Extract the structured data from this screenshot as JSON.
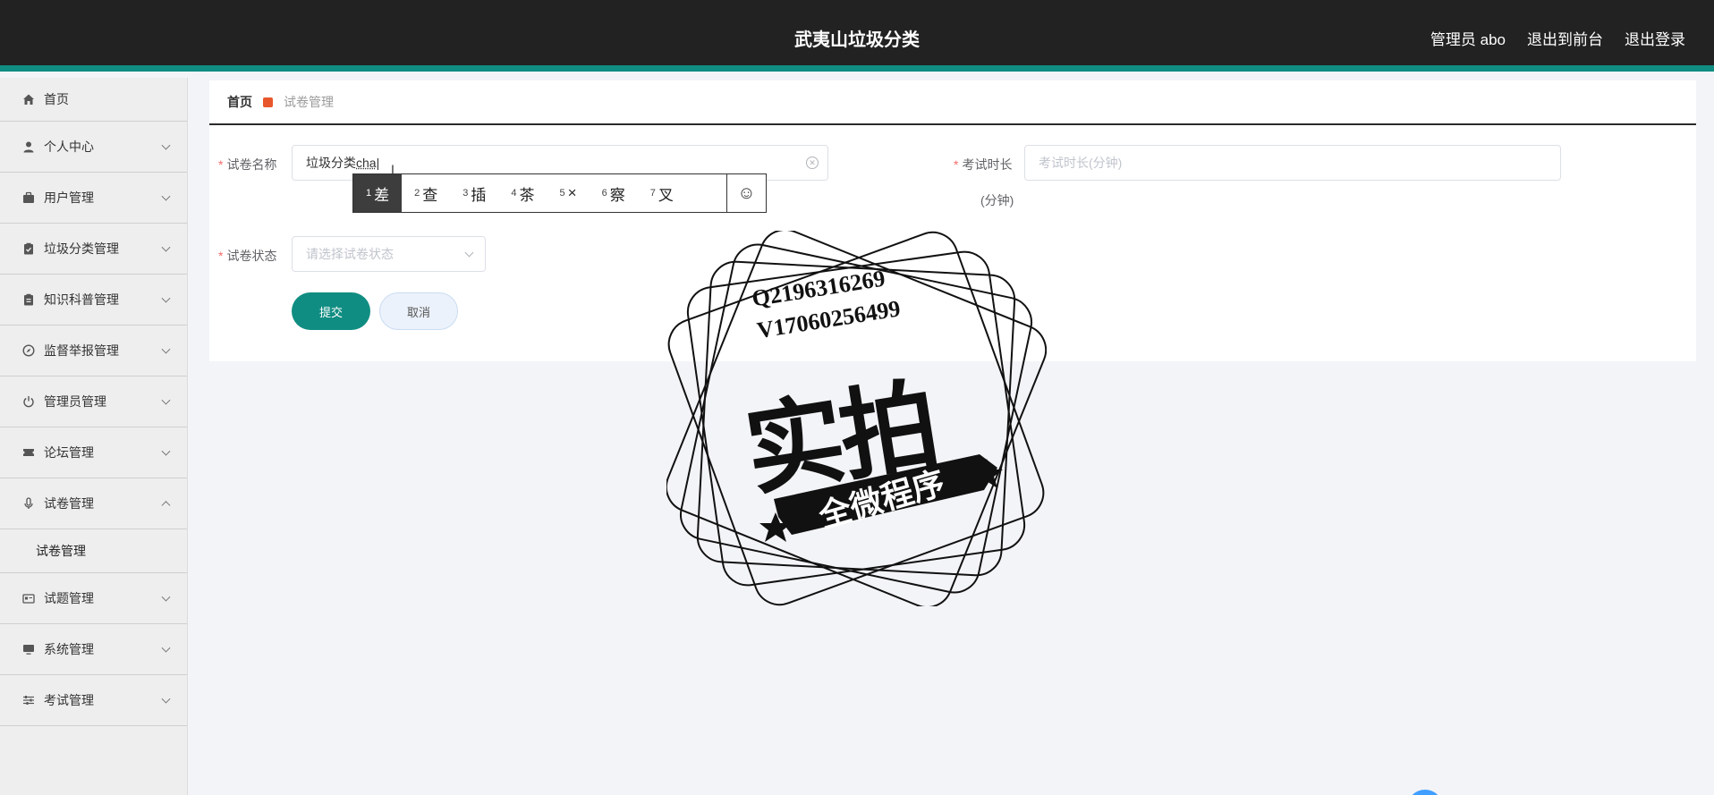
{
  "header": {
    "title": "武夷山垃圾分类",
    "links": [
      "管理员 abo",
      "退出到前台",
      "退出登录"
    ]
  },
  "sidebar": {
    "items": [
      {
        "label": "首页",
        "icon": "home-icon"
      },
      {
        "label": "个人中心",
        "icon": "user-icon"
      },
      {
        "label": "用户管理",
        "icon": "briefcase-icon"
      },
      {
        "label": "垃圾分类管理",
        "icon": "clipboard-check-icon"
      },
      {
        "label": "知识科普管理",
        "icon": "clipboard-icon"
      },
      {
        "label": "监督举报管理",
        "icon": "compass-icon"
      },
      {
        "label": "管理员管理",
        "icon": "power-icon"
      },
      {
        "label": "论坛管理",
        "icon": "ticket-icon"
      },
      {
        "label": "试卷管理",
        "icon": "microphone-icon"
      },
      {
        "label": "试题管理",
        "icon": "id-card-icon"
      },
      {
        "label": "系统管理",
        "icon": "monitor-icon"
      },
      {
        "label": "考试管理",
        "icon": "sliders-icon"
      }
    ],
    "submenu": [
      "试卷管理"
    ]
  },
  "breadcrumb": {
    "home": "首页",
    "current": "试卷管理"
  },
  "form": {
    "name_label": "试卷名称",
    "name_value_prefix": "垃圾分类",
    "name_value_composing": "cha",
    "duration_label": "考试时长",
    "duration_placeholder": "考试时长(分钟)",
    "duration_unit": "(分钟)",
    "status_label": "试卷状态",
    "status_placeholder": "请选择试卷状态",
    "submit": "提交",
    "cancel": "取消"
  },
  "ime": {
    "candidates": [
      {
        "num": "1",
        "text": "差"
      },
      {
        "num": "2",
        "text": "查"
      },
      {
        "num": "3",
        "text": "插"
      },
      {
        "num": "4",
        "text": "茶"
      },
      {
        "num": "5",
        "text": "×"
      },
      {
        "num": "6",
        "text": "察"
      },
      {
        "num": "7",
        "text": "叉"
      }
    ],
    "emoji": "☺"
  },
  "watermark": {
    "line1": "Q2196316269",
    "line2": "V17060256499",
    "big": "实拍",
    "ribbon": "全微程序"
  },
  "colors": {
    "accent": "#108d82",
    "topbar": "#222222",
    "required": "#f56c6c",
    "breadcrumb_marker": "#e8572b"
  }
}
